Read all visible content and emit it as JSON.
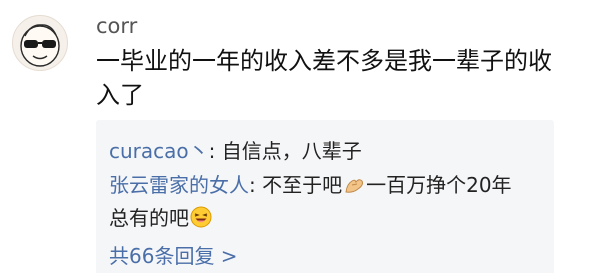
{
  "comment": {
    "username": "corr",
    "avatar_icon": "cartoon-face-with-sunglasses",
    "text": "一毕业的一年的收入差不多是我一辈子的收入了"
  },
  "replies": [
    {
      "author": "curacao丶",
      "separator": ": ",
      "text": "自信点，八辈子"
    },
    {
      "author": "张云雷家的女人",
      "separator": ": ",
      "text_before_emoji": "不至于吧",
      "emoji_1": "folded-hands-emoji",
      "text_middle": "一百万挣个20年总有的吧",
      "emoji_2": "laughing-face-emoji"
    }
  ],
  "more_replies_label": "共66条回复 >",
  "colors": {
    "link": "#4a6fa8",
    "reply_background": "#f5f6f8",
    "username": "#555555"
  }
}
